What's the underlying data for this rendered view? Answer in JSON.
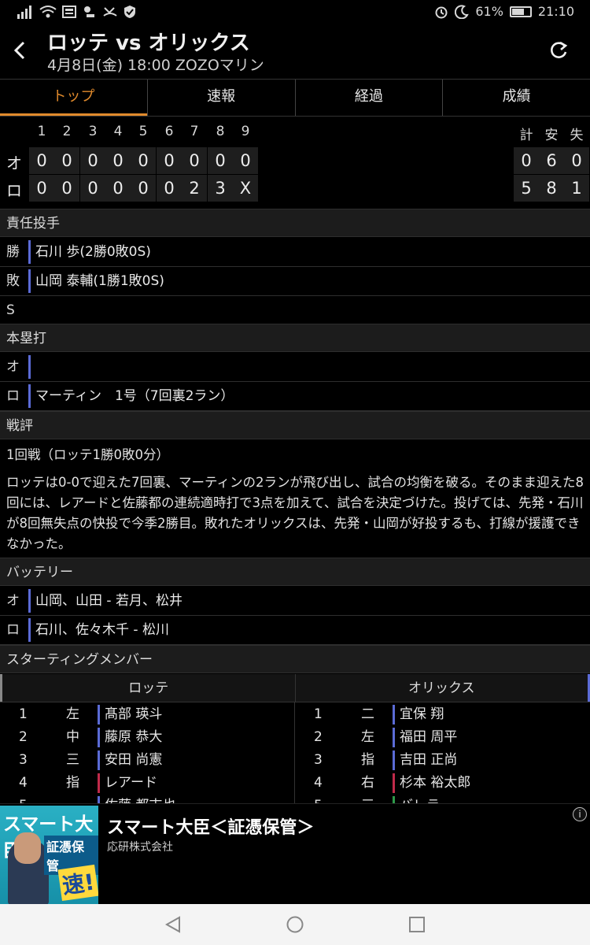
{
  "status": {
    "battery": "61%",
    "time": "21:10"
  },
  "header": {
    "title": "ロッテ vs オリックス",
    "subtitle": "4月8日(金) 18:00 ZOZOマリン"
  },
  "tabs": [
    "トップ",
    "速報",
    "経過",
    "成績"
  ],
  "scoreboard": {
    "innings": [
      "1",
      "2",
      "3",
      "4",
      "5",
      "6",
      "7",
      "8",
      "9"
    ],
    "total_labels": [
      "計",
      "安",
      "失"
    ],
    "teams": [
      {
        "label": "オ",
        "scores": [
          "0",
          "0",
          "0",
          "0",
          "0",
          "0",
          "0",
          "0",
          "0"
        ],
        "totals": [
          "0",
          "6",
          "0"
        ]
      },
      {
        "label": "ロ",
        "scores": [
          "0",
          "0",
          "0",
          "0",
          "0",
          "0",
          "2",
          "3",
          "X"
        ],
        "totals": [
          "5",
          "8",
          "1"
        ]
      }
    ]
  },
  "pitchers": {
    "title": "責任投手",
    "rows": [
      {
        "key": "勝",
        "value": "石川 歩(2勝0敗0S)"
      },
      {
        "key": "敗",
        "value": "山岡 泰輔(1勝1敗0S)"
      },
      {
        "key": "S",
        "value": ""
      }
    ]
  },
  "homeruns": {
    "title": "本塁打",
    "rows": [
      {
        "key": "オ",
        "value": ""
      },
      {
        "key": "ロ",
        "value": "マーティン　1号（7回裏2ラン）"
      }
    ]
  },
  "review": {
    "title": "戦評",
    "record": "1回戦（ロッテ1勝0敗0分）",
    "text": "ロッテは0-0で迎えた7回裏、マーティンの2ランが飛び出し、試合の均衡を破る。そのまま迎えた8回には、レアードと佐藤都の連続適時打で3点を加えて、試合を決定づけた。投げては、先発・石川が8回無失点の快投で今季2勝目。敗れたオリックスは、先発・山岡が好投するも、打線が援護できなかった。"
  },
  "battery": {
    "title": "バッテリー",
    "rows": [
      {
        "key": "オ",
        "value": "山岡、山田 - 若月、松井"
      },
      {
        "key": "ロ",
        "value": "石川、佐々木千 - 松川"
      }
    ]
  },
  "starting": {
    "title": "スターティングメンバー",
    "teams": [
      "ロッテ",
      "オリックス"
    ],
    "lotte": [
      {
        "order": "1",
        "pos": "左",
        "name": "髙部 瑛斗"
      },
      {
        "order": "2",
        "pos": "中",
        "name": "藤原 恭大"
      },
      {
        "order": "3",
        "pos": "三",
        "name": "安田 尚憲"
      },
      {
        "order": "4",
        "pos": "指",
        "name": "レアード"
      },
      {
        "order": "5",
        "pos": "一",
        "name": "佐藤 都志也"
      }
    ],
    "orix": [
      {
        "order": "1",
        "pos": "二",
        "name": "宜保 翔"
      },
      {
        "order": "2",
        "pos": "左",
        "name": "福田 周平"
      },
      {
        "order": "3",
        "pos": "指",
        "name": "吉田 正尚"
      },
      {
        "order": "4",
        "pos": "右",
        "name": "杉本 裕太郎"
      },
      {
        "order": "5",
        "pos": "三",
        "name": "バレラ"
      }
    ]
  },
  "ad": {
    "image_text_1": "スマート大臣",
    "image_text_2": "証憑保管",
    "image_text_3": "速!",
    "title": "スマート大臣＜証憑保管＞",
    "advertiser": "応研株式会社"
  }
}
